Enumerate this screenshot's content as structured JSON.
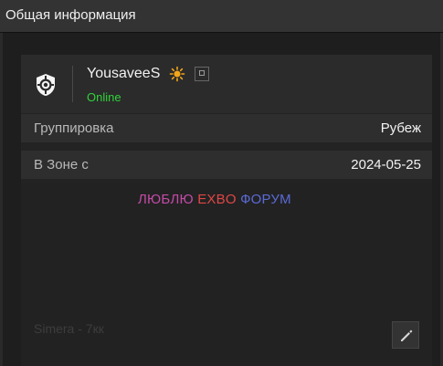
{
  "header": {
    "title": "Общая информация"
  },
  "user": {
    "name": "YousaveeS",
    "status": "Online",
    "icons": [
      "shield-target-icon",
      "sun-badge-icon",
      "copy-icon"
    ]
  },
  "rows": [
    {
      "label": "Группировка",
      "value": "Рубеж"
    },
    {
      "label": "В Зоне с",
      "value": "2024-05-25"
    }
  ],
  "about": {
    "words": [
      {
        "text": "ЛЮБЛЮ",
        "color": "#c44aa7"
      },
      {
        "text": "EXBO",
        "color": "#e04646"
      },
      {
        "text": "ФОРУМ",
        "color": "#5b6ad6"
      }
    ],
    "note": "Simera - 7кк"
  },
  "actions": {
    "edit_icon": "pencil-icon"
  }
}
